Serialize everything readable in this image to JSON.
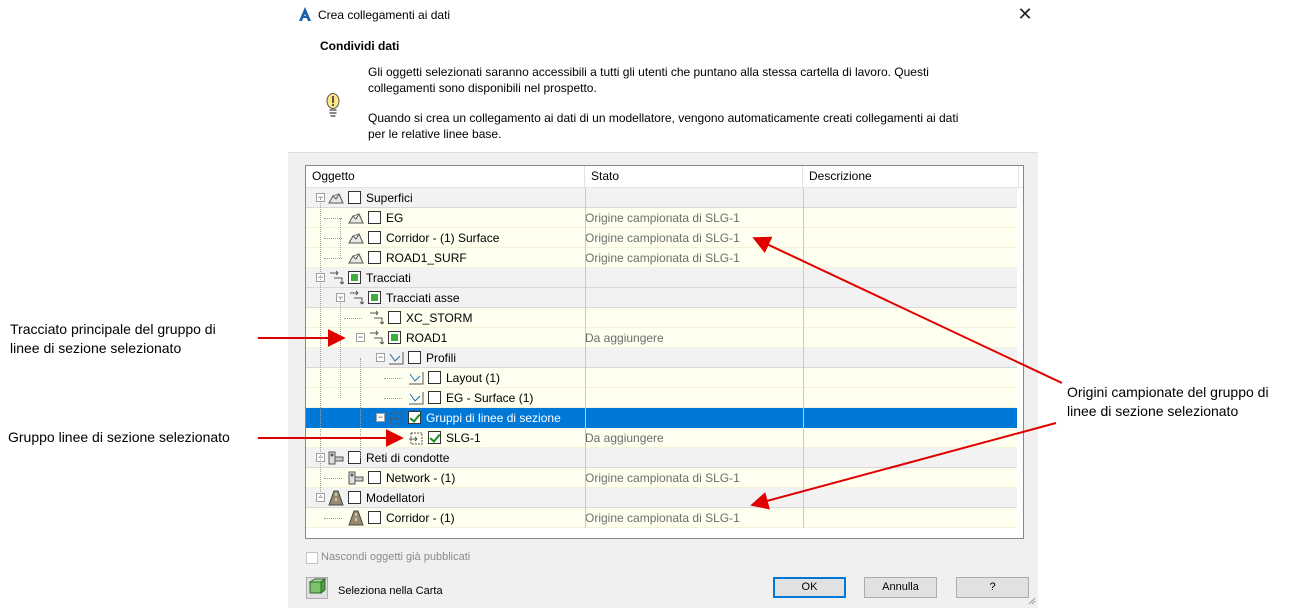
{
  "window": {
    "title": "Crea collegamenti ai dati",
    "close": "✕"
  },
  "header": {
    "title": "Condividi dati",
    "para1_line1": "Gli oggetti selezionati saranno accessibili a tutti gli utenti che puntano alla stessa cartella di lavoro. Questi",
    "para1_line2": "collegamenti sono disponibili nel prospetto.",
    "para2_line1": "Quando si crea un collegamento ai dati di un modellatore, vengono automaticamente creati collegamenti ai dati",
    "para2_line2": "per le relative linee base."
  },
  "tree": {
    "columns": {
      "oggetto": "Oggetto",
      "stato": "Stato",
      "descrizione": "Descrizione"
    },
    "rows": [
      {
        "label": "Superfici",
        "stato": "",
        "kind": "cat",
        "icon": "surface-icon"
      },
      {
        "label": "EG",
        "stato": "Origine campionata di SLG-1",
        "kind": "item",
        "icon": "surface-icon"
      },
      {
        "label": "Corridor - (1) Surface",
        "stato": "Origine campionata di SLG-1",
        "kind": "item",
        "icon": "surface-icon"
      },
      {
        "label": "ROAD1_SURF",
        "stato": "Origine campionata di SLG-1",
        "kind": "item",
        "icon": "surface-icon"
      },
      {
        "label": "Tracciati",
        "stato": "",
        "kind": "cat",
        "icon": "alignment-icon"
      },
      {
        "label": "Tracciati asse",
        "stato": "",
        "kind": "cat",
        "icon": "alignment-icon"
      },
      {
        "label": "XC_STORM",
        "stato": "",
        "kind": "item",
        "icon": "alignment-icon"
      },
      {
        "label": "ROAD1",
        "stato": "Da aggiungere",
        "kind": "item",
        "icon": "alignment-icon"
      },
      {
        "label": "Profili",
        "stato": "",
        "kind": "cat",
        "icon": "profile-icon"
      },
      {
        "label": "Layout (1)",
        "stato": "",
        "kind": "item",
        "icon": "profile-icon"
      },
      {
        "label": "EG - Surface (1)",
        "stato": "",
        "kind": "item",
        "icon": "profile-icon"
      },
      {
        "label": "Gruppi di linee di sezione",
        "stato": "",
        "kind": "sel",
        "icon": "sample-line-icon"
      },
      {
        "label": "SLG-1",
        "stato": "Da aggiungere",
        "kind": "item",
        "icon": "sample-line-icon"
      },
      {
        "label": "Reti di condotte",
        "stato": "",
        "kind": "cat",
        "icon": "pipe-network-icon"
      },
      {
        "label": "Network - (1)",
        "stato": "Origine campionata di SLG-1",
        "kind": "item",
        "icon": "pipe-network-icon"
      },
      {
        "label": "Modellatori",
        "stato": "",
        "kind": "cat",
        "icon": "corridor-icon"
      },
      {
        "label": "Corridor - (1)",
        "stato": "Origine campionata di SLG-1",
        "kind": "item",
        "icon": "corridor-icon"
      }
    ]
  },
  "footer": {
    "hide_published": "Nascondi oggetti già pubblicati",
    "select_in_map": "Seleziona nella Carta",
    "ok": "OK",
    "cancel": "Annulla",
    "help": "?"
  },
  "annotations": {
    "left1_line1": "Tracciato principale del gruppo di",
    "left1_line2": "linee di sezione selezionato",
    "left2": "Gruppo linee di sezione selezionato",
    "right_line1": "Origini campionate del gruppo di",
    "right_line2": "linee di sezione selezionato"
  },
  "colors": {
    "selection": "#0078d7",
    "arrow": "#e00000",
    "row_item": "#fffff0",
    "row_cat": "#f2f2f2"
  }
}
